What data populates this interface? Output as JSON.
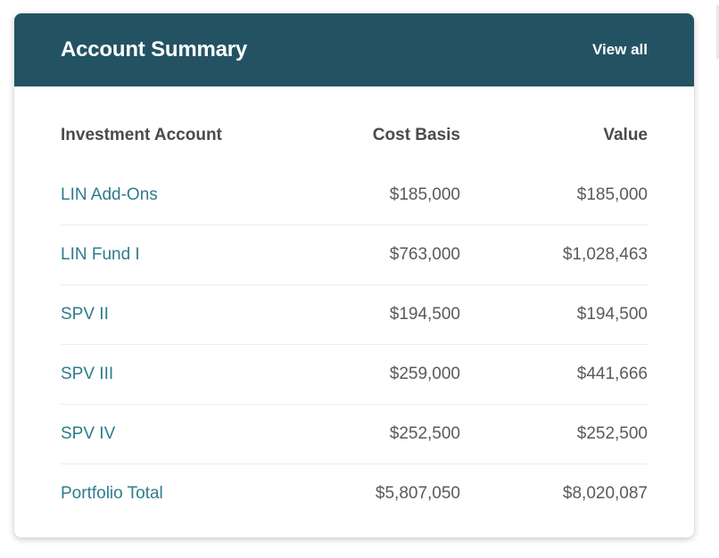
{
  "card": {
    "title": "Account Summary",
    "view_all_label": "View all"
  },
  "table": {
    "columns": [
      "Investment Account",
      "Cost Basis",
      "Value"
    ],
    "rows": [
      {
        "account": "LIN Add-Ons",
        "cost_basis": "$185,000",
        "value": "$185,000"
      },
      {
        "account": "LIN Fund I",
        "cost_basis": "$763,000",
        "value": "$1,028,463"
      },
      {
        "account": "SPV II",
        "cost_basis": "$194,500",
        "value": "$194,500"
      },
      {
        "account": "SPV III",
        "cost_basis": "$259,000",
        "value": "$441,666"
      },
      {
        "account": "SPV IV",
        "cost_basis": "$252,500",
        "value": "$252,500"
      },
      {
        "account": "Portfolio Total",
        "cost_basis": "$5,807,050",
        "value": "$8,020,087"
      }
    ]
  },
  "colors": {
    "header_bg": "#235363",
    "link": "#2e7c8c",
    "text": "#5a5a5a"
  }
}
